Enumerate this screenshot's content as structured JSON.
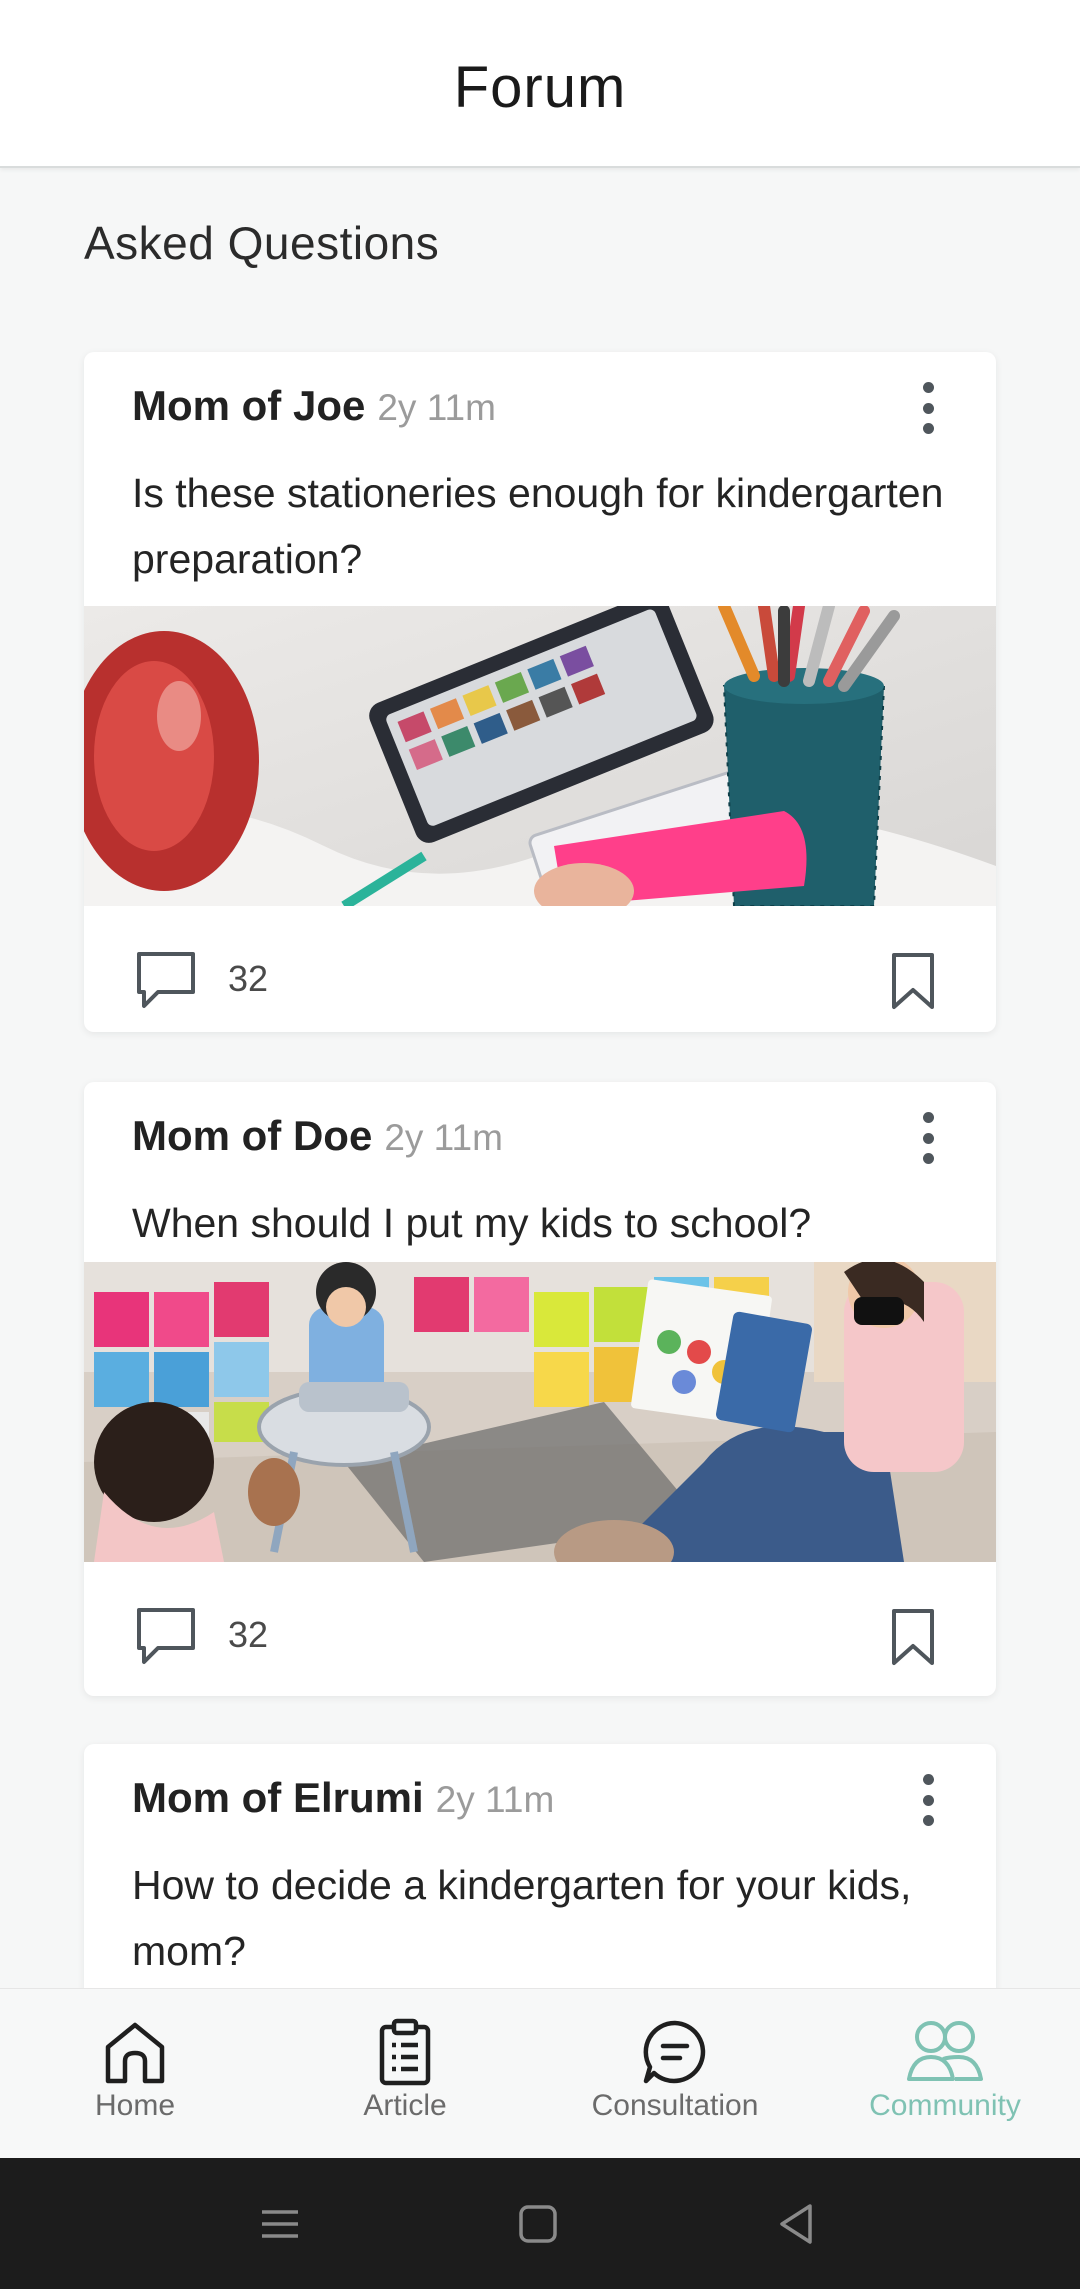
{
  "header": {
    "title": "Forum"
  },
  "section": {
    "title": "Asked Questions"
  },
  "posts": [
    {
      "author": "Mom of Joe",
      "time": "2y 11m",
      "question": "Is these stationeries enough for kindergarten preparation?",
      "image": "stationery-photo",
      "comments": "32"
    },
    {
      "author": "Mom of Doe",
      "time": "2y 11m",
      "question": "When should I put my kids to school?",
      "image": "classroom-photo",
      "comments": "32"
    },
    {
      "author": "Mom of Elrumi",
      "time": "2y 11m",
      "question": "How to decide a kindergarten for your kids, mom?"
    }
  ],
  "nav": {
    "items": [
      {
        "label": "Home",
        "icon": "home-icon"
      },
      {
        "label": "Article",
        "icon": "clipboard-icon"
      },
      {
        "label": "Consultation",
        "icon": "chat-icon"
      },
      {
        "label": "Community",
        "icon": "community-icon",
        "active": true
      }
    ]
  },
  "colors": {
    "accent": "#7fc2b3",
    "icon": "#4f565c"
  }
}
